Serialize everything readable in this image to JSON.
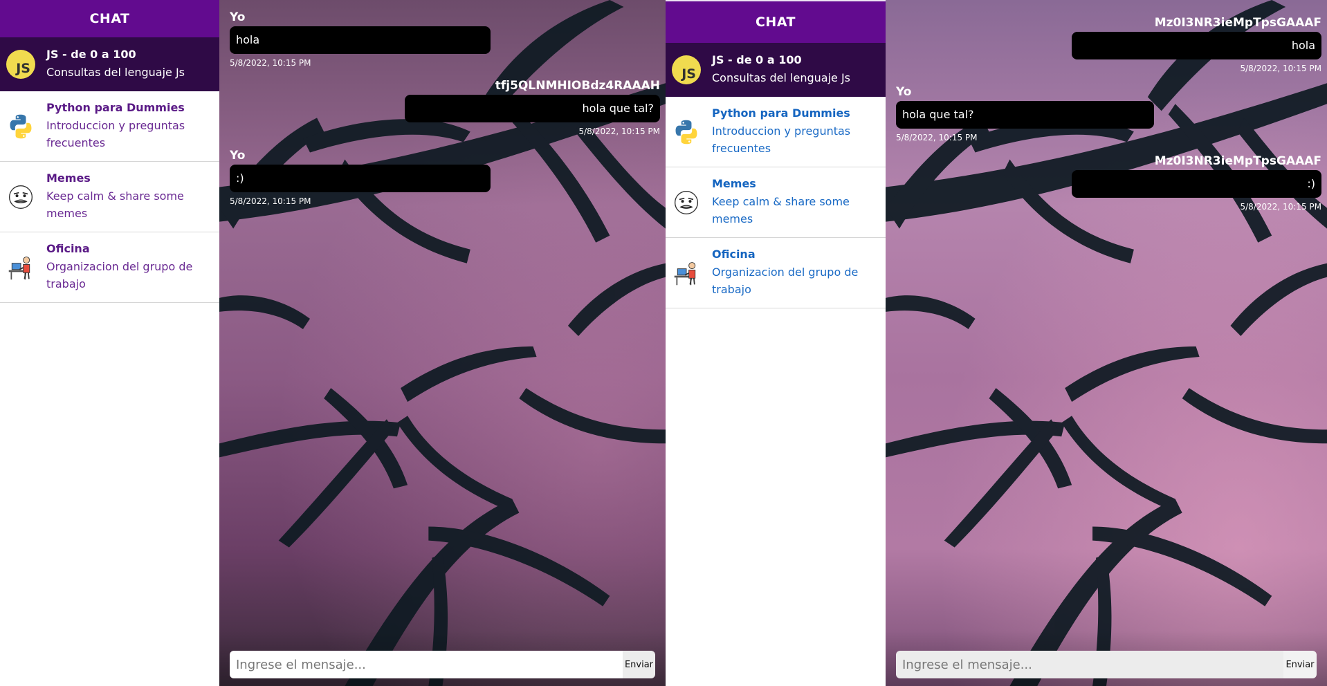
{
  "colors": {
    "header_purple": "#620b8f",
    "active_room": "#2f0a46",
    "bubble": "#000000",
    "left_link": "#5a1a86",
    "right_link": "#1565c0"
  },
  "icons": {
    "js": "js-icon",
    "python": "python-icon",
    "memes": "meme-face-icon",
    "office": "office-worker-icon",
    "palms": "palm-trees-background"
  },
  "panes": [
    {
      "sidebar": {
        "title": "CHAT",
        "rooms": [
          {
            "title": "JS - de 0 a 100",
            "desc": "Consultas del lenguaje Js",
            "badge": "JS"
          },
          {
            "title": "Python para Dummies",
            "desc": "Introduccion y preguntas frecuentes"
          },
          {
            "title": "Memes",
            "desc": "Keep calm & share some memes"
          },
          {
            "title": "Oficina",
            "desc": "Organizacion del grupo de trabajo"
          }
        ]
      },
      "messages": [
        {
          "author": "Yo",
          "text": "hola",
          "time": "5/8/2022, 10:15 PM",
          "mine": true
        },
        {
          "author": "tfj5QLNMHIOBdz4RAAAH",
          "text": "hola que tal?",
          "time": "5/8/2022, 10:15 PM",
          "mine": false
        },
        {
          "author": "Yo",
          "text": ":)",
          "time": "5/8/2022, 10:15 PM",
          "mine": true
        }
      ],
      "composer": {
        "placeholder": "Ingrese el mensaje...",
        "send_label": "Enviar"
      }
    },
    {
      "sidebar": {
        "title": "CHAT",
        "rooms": [
          {
            "title": "JS - de 0 a 100",
            "desc": "Consultas del lenguaje Js",
            "badge": "JS"
          },
          {
            "title": "Python para Dummies",
            "desc": "Introduccion y preguntas frecuentes"
          },
          {
            "title": "Memes",
            "desc": "Keep calm & share some memes"
          },
          {
            "title": "Oficina",
            "desc": "Organizacion del grupo de trabajo"
          }
        ]
      },
      "messages": [
        {
          "author": "Mz0I3NR3ieMpTpsGAAAF",
          "text": "hola",
          "time": "5/8/2022, 10:15 PM",
          "mine": false
        },
        {
          "author": "Yo",
          "text": "hola que tal?",
          "time": "5/8/2022, 10:15 PM",
          "mine": true
        },
        {
          "author": "Mz0I3NR3ieMpTpsGAAAF",
          "text": ":)",
          "time": "5/8/2022, 10:15 PM",
          "mine": false
        }
      ],
      "composer": {
        "placeholder": "Ingrese el mensaje...",
        "send_label": "Enviar"
      }
    }
  ]
}
